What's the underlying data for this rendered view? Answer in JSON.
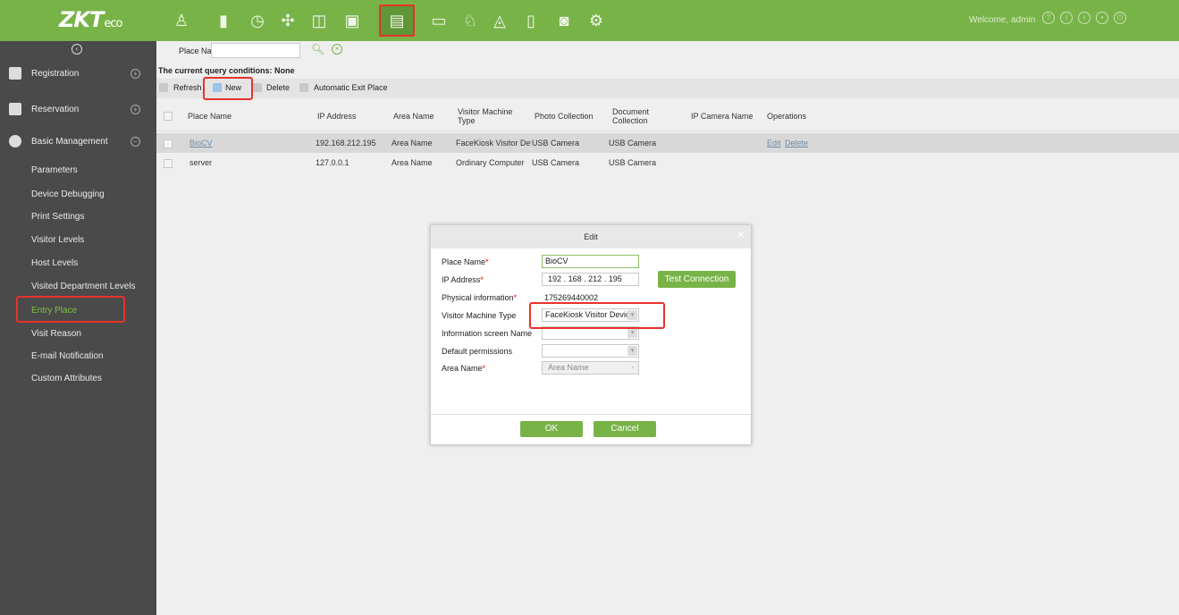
{
  "app": {
    "logo_main": "ZKT",
    "logo_sub": "eco",
    "welcome": "Welcome, admin"
  },
  "colors": {
    "brand_green": "#78b348",
    "sidebar": "#4a4a4a",
    "highlight_red": "#e8322a"
  },
  "nav_icons": [
    "person-icon",
    "door-icon",
    "clock-icon",
    "elevator-icon",
    "access-panel-icon",
    "visitor-icon",
    "parking-icon",
    "patrol-icon",
    "entrance-icon",
    "locker-icon",
    "video-icon",
    "settings-icon"
  ],
  "sidebar": {
    "menu": [
      "Registration",
      "Reservation",
      "Basic Management"
    ],
    "items": [
      "Parameters",
      "Device Debugging",
      "Print Settings",
      "Visitor Levels",
      "Host Levels",
      "Visited Department Levels",
      "Entry Place",
      "Visit Reason",
      "E-mail Notification",
      "Custom Attributes"
    ]
  },
  "query": {
    "label": "Place Name",
    "value": "",
    "conditions": "The current query conditions: None"
  },
  "toolbar": {
    "refresh": "Refresh",
    "new": "New",
    "delete": "Delete",
    "auto_exit": "Automatic Exit Place"
  },
  "table": {
    "columns": [
      "Place Name",
      "IP Address",
      "Area Name",
      "Visitor Machine Type",
      "Photo Collection",
      "Document Collection",
      "IP Camera Name",
      "Operations"
    ],
    "rows": [
      {
        "place": "BioCV",
        "ip": "192.168.212.195",
        "area": "Area Name",
        "type": "FaceKiosk Visitor Dev",
        "photo": "USB Camera",
        "doc": "USB Camera",
        "camera": "",
        "edit": "Edit",
        "del": "Delete"
      },
      {
        "place": "server",
        "ip": "127.0.0.1",
        "area": "Area Name",
        "type": "Ordinary Computer",
        "photo": "USB Camera",
        "doc": "USB Camera",
        "camera": "",
        "edit": "",
        "del": ""
      }
    ]
  },
  "dialog": {
    "title": "Edit",
    "place_label": "Place Name",
    "place_value": "BioCV",
    "ip_label": "IP Address",
    "ip_values": [
      "192",
      "168",
      "212",
      "195"
    ],
    "ip_dot": ".",
    "test_btn": "Test Connection",
    "physical_label": "Physical information",
    "physical_value": "175269440002",
    "type_label": "Visitor Machine Type",
    "type_value": "FaceKiosk Visitor Devic",
    "screen_label": "Information screen Name",
    "perm_label": "Default permissions",
    "area_label": "Area Name",
    "area_value": "Area Name",
    "ok": "OK",
    "cancel": "Cancel",
    "required_mark": "*"
  }
}
